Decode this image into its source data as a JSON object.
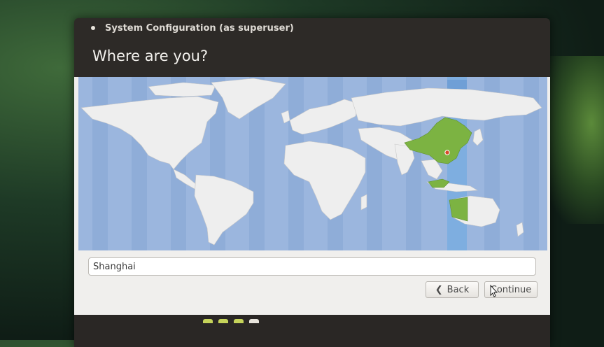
{
  "window": {
    "title": "System Configuration (as superuser)"
  },
  "page": {
    "heading": "Where are you?"
  },
  "location": {
    "value": "Shanghai",
    "marker_icon": "location-marker-icon",
    "highlight_color": "#7cb342"
  },
  "buttons": {
    "back_label": "Back",
    "continue_label": "Continue",
    "back_icon": "chevron-left-icon"
  },
  "progress": {
    "step_colors": [
      "#c5d35a",
      "#c5d35a",
      "#c5d35a",
      "#e8e4dc"
    ]
  },
  "colors": {
    "ocean": "#9bb6de",
    "land": "#eeeeee",
    "selected_zone": "#7eaee0"
  }
}
